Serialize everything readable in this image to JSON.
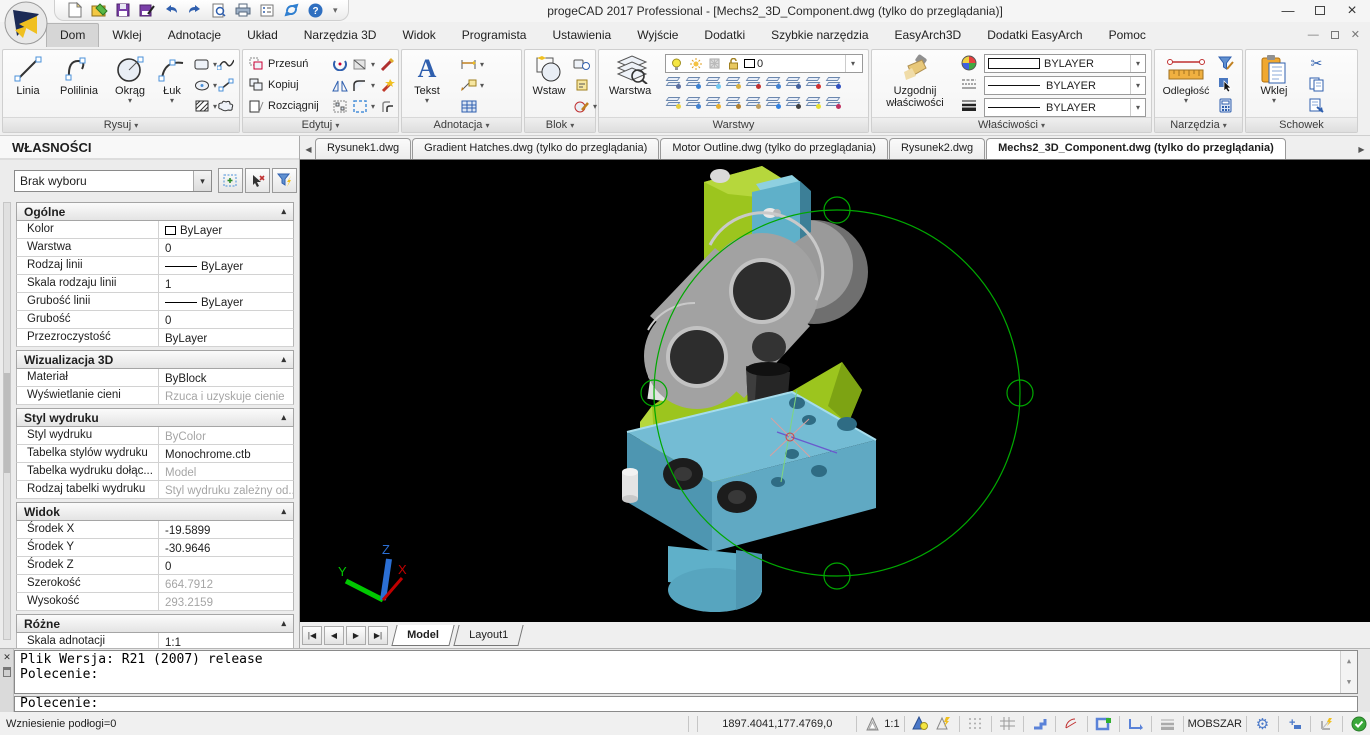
{
  "icons": {
    "dropdown": "▾",
    "up": "▴",
    "left": "◀",
    "right": "▶",
    "close": "×",
    "minimize": "—",
    "check": "✓",
    "scissors": "✂",
    "question": "?",
    "nav_first": "|◀",
    "nav_prev": "◀",
    "nav_next": "▶",
    "nav_last": "▶|",
    "scroll_up": "▲",
    "scroll_down": "▼",
    "gear": "⚙",
    "plus": "+",
    "x_small": "✕",
    "big_a": "A"
  },
  "window": {
    "title": "progeCAD 2017 Professional - [Mechs2_3D_Component.dwg (tylko do przeglądania)]"
  },
  "tabs": {
    "items": [
      {
        "label": "Dom",
        "active": true
      },
      {
        "label": "Wklej"
      },
      {
        "label": "Adnotacje"
      },
      {
        "label": "Układ"
      },
      {
        "label": "Narzędzia 3D"
      },
      {
        "label": "Widok"
      },
      {
        "label": "Programista"
      },
      {
        "label": "Ustawienia"
      },
      {
        "label": "Wyjście"
      },
      {
        "label": "Dodatki"
      },
      {
        "label": "Szybkie narzędzia"
      },
      {
        "label": "EasyArch3D"
      },
      {
        "label": "Dodatki EasyArch"
      },
      {
        "label": "Pomoc"
      }
    ]
  },
  "ribbon": {
    "rysuj": {
      "label": "Rysuj",
      "items": [
        "Linia",
        "Polilinia",
        "Okrąg",
        "Łuk"
      ]
    },
    "edytuj": {
      "label": "Edytuj",
      "items": [
        "Przesuń",
        "Kopiuj",
        "Rozciągnij"
      ]
    },
    "adnotacja": {
      "label": "Adnotacja",
      "items": [
        "Tekst"
      ]
    },
    "blok": {
      "label": "Blok",
      "items": [
        "Wstaw"
      ]
    },
    "warstwy": {
      "label": "Warstwy",
      "items": [
        "Warstwa"
      ],
      "layer": "0"
    },
    "wlasciwosci": {
      "label": "Właściwości",
      "items": [
        "Uzgodnij właściwości"
      ],
      "combos": [
        "BYLAYER",
        "BYLAYER",
        "BYLAYER"
      ]
    },
    "narzedzia": {
      "label": "Narzędzia",
      "items": [
        "Odległość"
      ]
    },
    "schowek": {
      "label": "Schowek",
      "items": [
        "Wklej"
      ]
    }
  },
  "doc_tabs": {
    "items": [
      {
        "label": "Rysunek1.dwg",
        "active": false
      },
      {
        "label": "Gradient Hatches.dwg (tylko do przeglądania)",
        "active": false
      },
      {
        "label": "Motor Outline.dwg (tylko do przeglądania)",
        "active": false
      },
      {
        "label": "Rysunek2.dwg",
        "active": false
      },
      {
        "label": "Mechs2_3D_Component.dwg (tylko do przeglądania)",
        "active": true
      }
    ]
  },
  "props": {
    "title": "WŁASNOŚCI",
    "selection": "Brak wyboru",
    "sections": [
      {
        "title": "Ogólne",
        "rows": [
          {
            "label": "Kolor",
            "value": "ByLayer"
          },
          {
            "label": "Warstwa",
            "value": "0"
          },
          {
            "label": "Rodzaj linii",
            "value": "ByLayer"
          },
          {
            "label": "Skala rodzaju linii",
            "value": "1"
          },
          {
            "label": "Grubość linii",
            "value": "ByLayer"
          },
          {
            "label": "Grubość",
            "value": "0"
          },
          {
            "label": "Przezroczystość",
            "value": "ByLayer"
          }
        ]
      },
      {
        "title": "Wizualizacja 3D",
        "rows": [
          {
            "label": "Materiał",
            "value": "ByBlock"
          },
          {
            "label": "Wyświetlanie cieni",
            "value": "Rzuca i uzyskuje cienie"
          }
        ]
      },
      {
        "title": "Styl wydruku",
        "rows": [
          {
            "label": "Styl wydruku",
            "value": "ByColor"
          },
          {
            "label": "Tabelka stylów wydruku",
            "value": "Monochrome.ctb"
          },
          {
            "label": "Tabelka wydruku dołąc...",
            "value": "Model"
          },
          {
            "label": "Rodzaj tabelki wydruku",
            "value": "Styl wydruku zależny od..."
          }
        ]
      },
      {
        "title": "Widok",
        "rows": [
          {
            "label": "Środek X",
            "value": "-19.5899"
          },
          {
            "label": "Środek Y",
            "value": "-30.9646"
          },
          {
            "label": "Środek Z",
            "value": "0"
          },
          {
            "label": "Szerokość",
            "value": "664.7912"
          },
          {
            "label": "Wysokość",
            "value": "293.2159"
          }
        ]
      },
      {
        "title": "Różne",
        "rows": [
          {
            "label": "Skala adnotacji",
            "value": "1:1"
          }
        ]
      }
    ]
  },
  "canvas": {
    "model_tab": "Model",
    "layout_tab": "Layout1",
    "axis": {
      "x": "X",
      "y": "Y",
      "z": "Z"
    }
  },
  "cmd": {
    "history": [
      "Plik Wersja: R21 (2007) release",
      "Polecenie:"
    ],
    "prompt": "Polecenie:"
  },
  "status": {
    "left": "Wzniesienie podłogi=0",
    "coords": "1897.4041,177.4769,0",
    "scale": "1:1",
    "mode": "MOBSZAR"
  },
  "colors": {
    "model_green": "#9cc51e",
    "model_blue": "#5fb0c9",
    "orbit": "#00a800",
    "canvas_bg": "#000000",
    "accent": "#3a6cb4"
  }
}
